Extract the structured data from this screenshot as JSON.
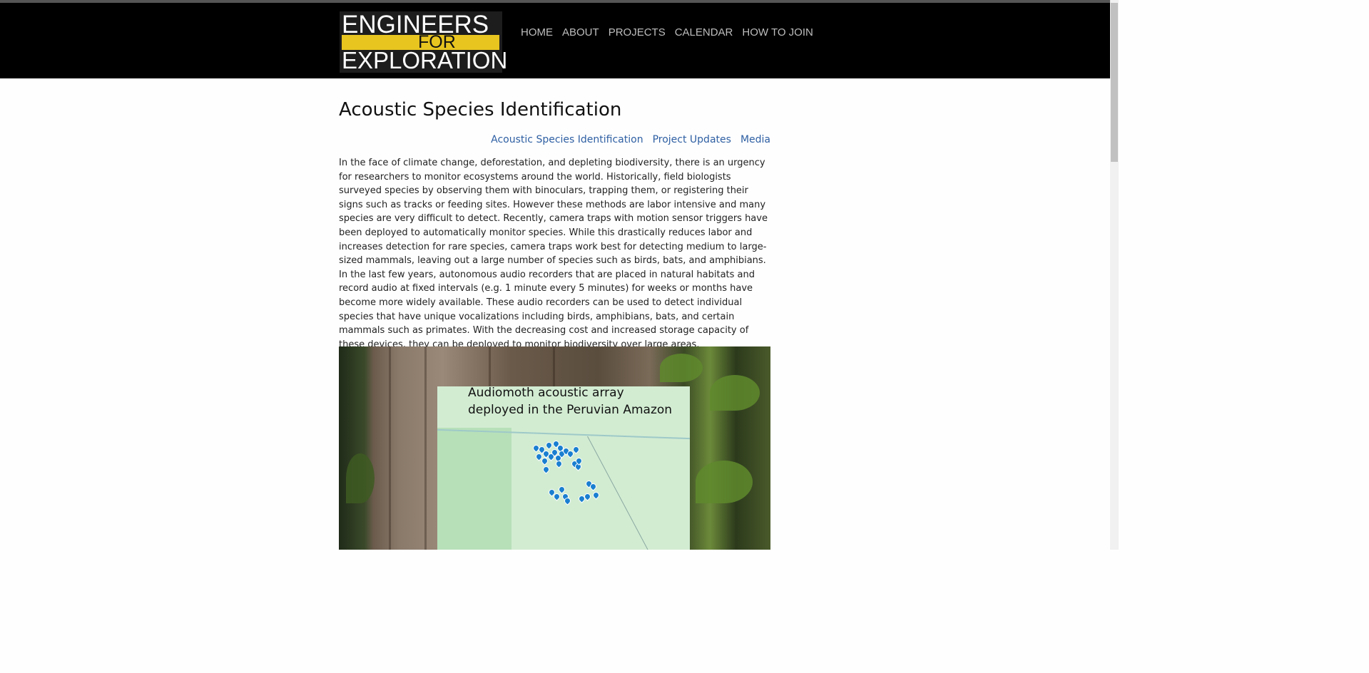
{
  "logo": {
    "line1": "ENGINEERS",
    "line2": "FOR",
    "line3": "EXPLORATION"
  },
  "nav": {
    "home": "HOME",
    "about": "ABOUT",
    "projects": "PROJECTS",
    "calendar": "CALENDAR",
    "join": "HOW TO JOIN"
  },
  "page": {
    "title": "Acoustic Species Identification",
    "subnav": {
      "a": "Acoustic Species Identification",
      "b": "Project Updates",
      "c": "Media"
    },
    "paragraph": "In the face of climate change, deforestation, and depleting biodiversity, there is an urgency for researchers to monitor ecosystems around the world. Historically, field biologists surveyed species by observing them with binoculars, trapping them, or registering their signs such as tracks or feeding sites. However these methods are labor intensive and many species are very difficult to detect. Recently, camera traps with motion sensor triggers have been deployed to automatically monitor species. While this drastically reduces labor and increases detection for rare species, camera traps work best for detecting medium to large-sized mammals, leaving out a large number of species such as birds, bats, and amphibians. In the last few years, autonomous audio recorders that are placed in natural habitats and record audio at fixed intervals (e.g. 1 minute every 5 minutes) for weeks or months have become more widely available. These audio recorders can be used to detect individual species that have unique vocalizations including birds, amphibians, bats, and certain mammals such as primates. With the decreasing cost and increased storage capacity of these devices, they can be deployed to monitor biodiversity over large areas.",
    "image_caption_line1": "Audiomoth acoustic array",
    "image_caption_line2": "deployed in the Peruvian Amazon"
  }
}
